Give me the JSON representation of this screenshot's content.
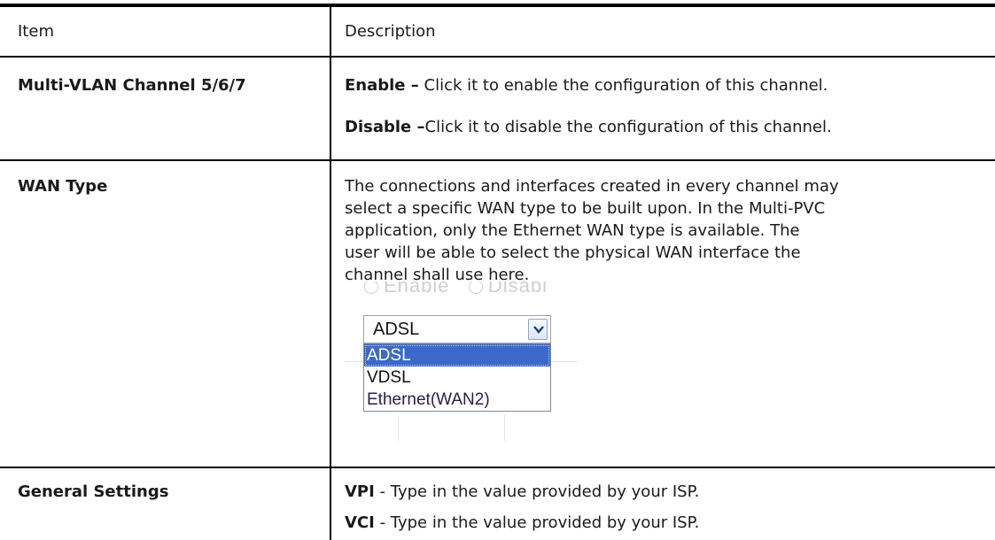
{
  "header": {
    "item": "Item",
    "description": "Description"
  },
  "rows": [
    {
      "item": "Multi-VLAN Channel 5/6/7",
      "lines": [
        {
          "term": "Enable –",
          "text": " Click it to enable the configuration of this channel."
        },
        {
          "term": "Disable –",
          "text": "Click it to disable the configuration of this channel."
        }
      ]
    },
    {
      "item": "WAN Type",
      "paragraph": [
        "The connections and interfaces created in every channel may",
        "select a specific WAN type to be built upon. In the Multi-PVC",
        "application, only the Ethernet WAN type is available. The",
        "user will be able to select the physical WAN interface the",
        "channel shall use here."
      ],
      "screenshot": {
        "ghost_text": [
          "Enable",
          "Disabl"
        ],
        "select_value": "ADSL",
        "options": [
          "ADSL",
          "VDSL",
          "Ethernet(WAN2)"
        ],
        "selected_option": "ADSL",
        "highlight_color": "#3a69c9"
      }
    },
    {
      "item": "General Settings",
      "lines": [
        {
          "term": "VPI",
          "text": " - Type in the value provided by your ISP."
        },
        {
          "term": "VCI",
          "text": " - Type in the value provided by your ISP."
        }
      ]
    }
  ]
}
